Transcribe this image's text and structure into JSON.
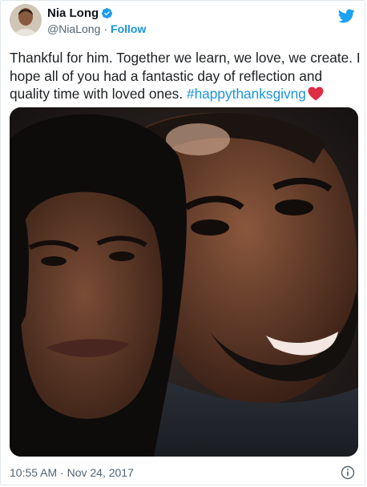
{
  "author": {
    "display_name": "Nia Long",
    "handle": "@NiaLong",
    "separator": "·",
    "follow_label": "Follow",
    "verified": true
  },
  "tweet": {
    "text_plain": "Thankful for him. Together we learn, we love, we create. I hope all of you had a fantastic day of reflection and quality time with loved ones.",
    "hashtag": "#happythanksgivng",
    "emoji": "red-heart"
  },
  "footer": {
    "timestamp": "10:55 AM · Nov 24, 2017",
    "info_icon": "info-icon"
  },
  "colors": {
    "link_blue": "#1b95e0",
    "verified_blue": "#1d9bf0",
    "twitter_bird": "#1da1f2",
    "heart_red": "#dd2e44",
    "secondary_text": "#536471",
    "primary_text": "#1c2022"
  }
}
